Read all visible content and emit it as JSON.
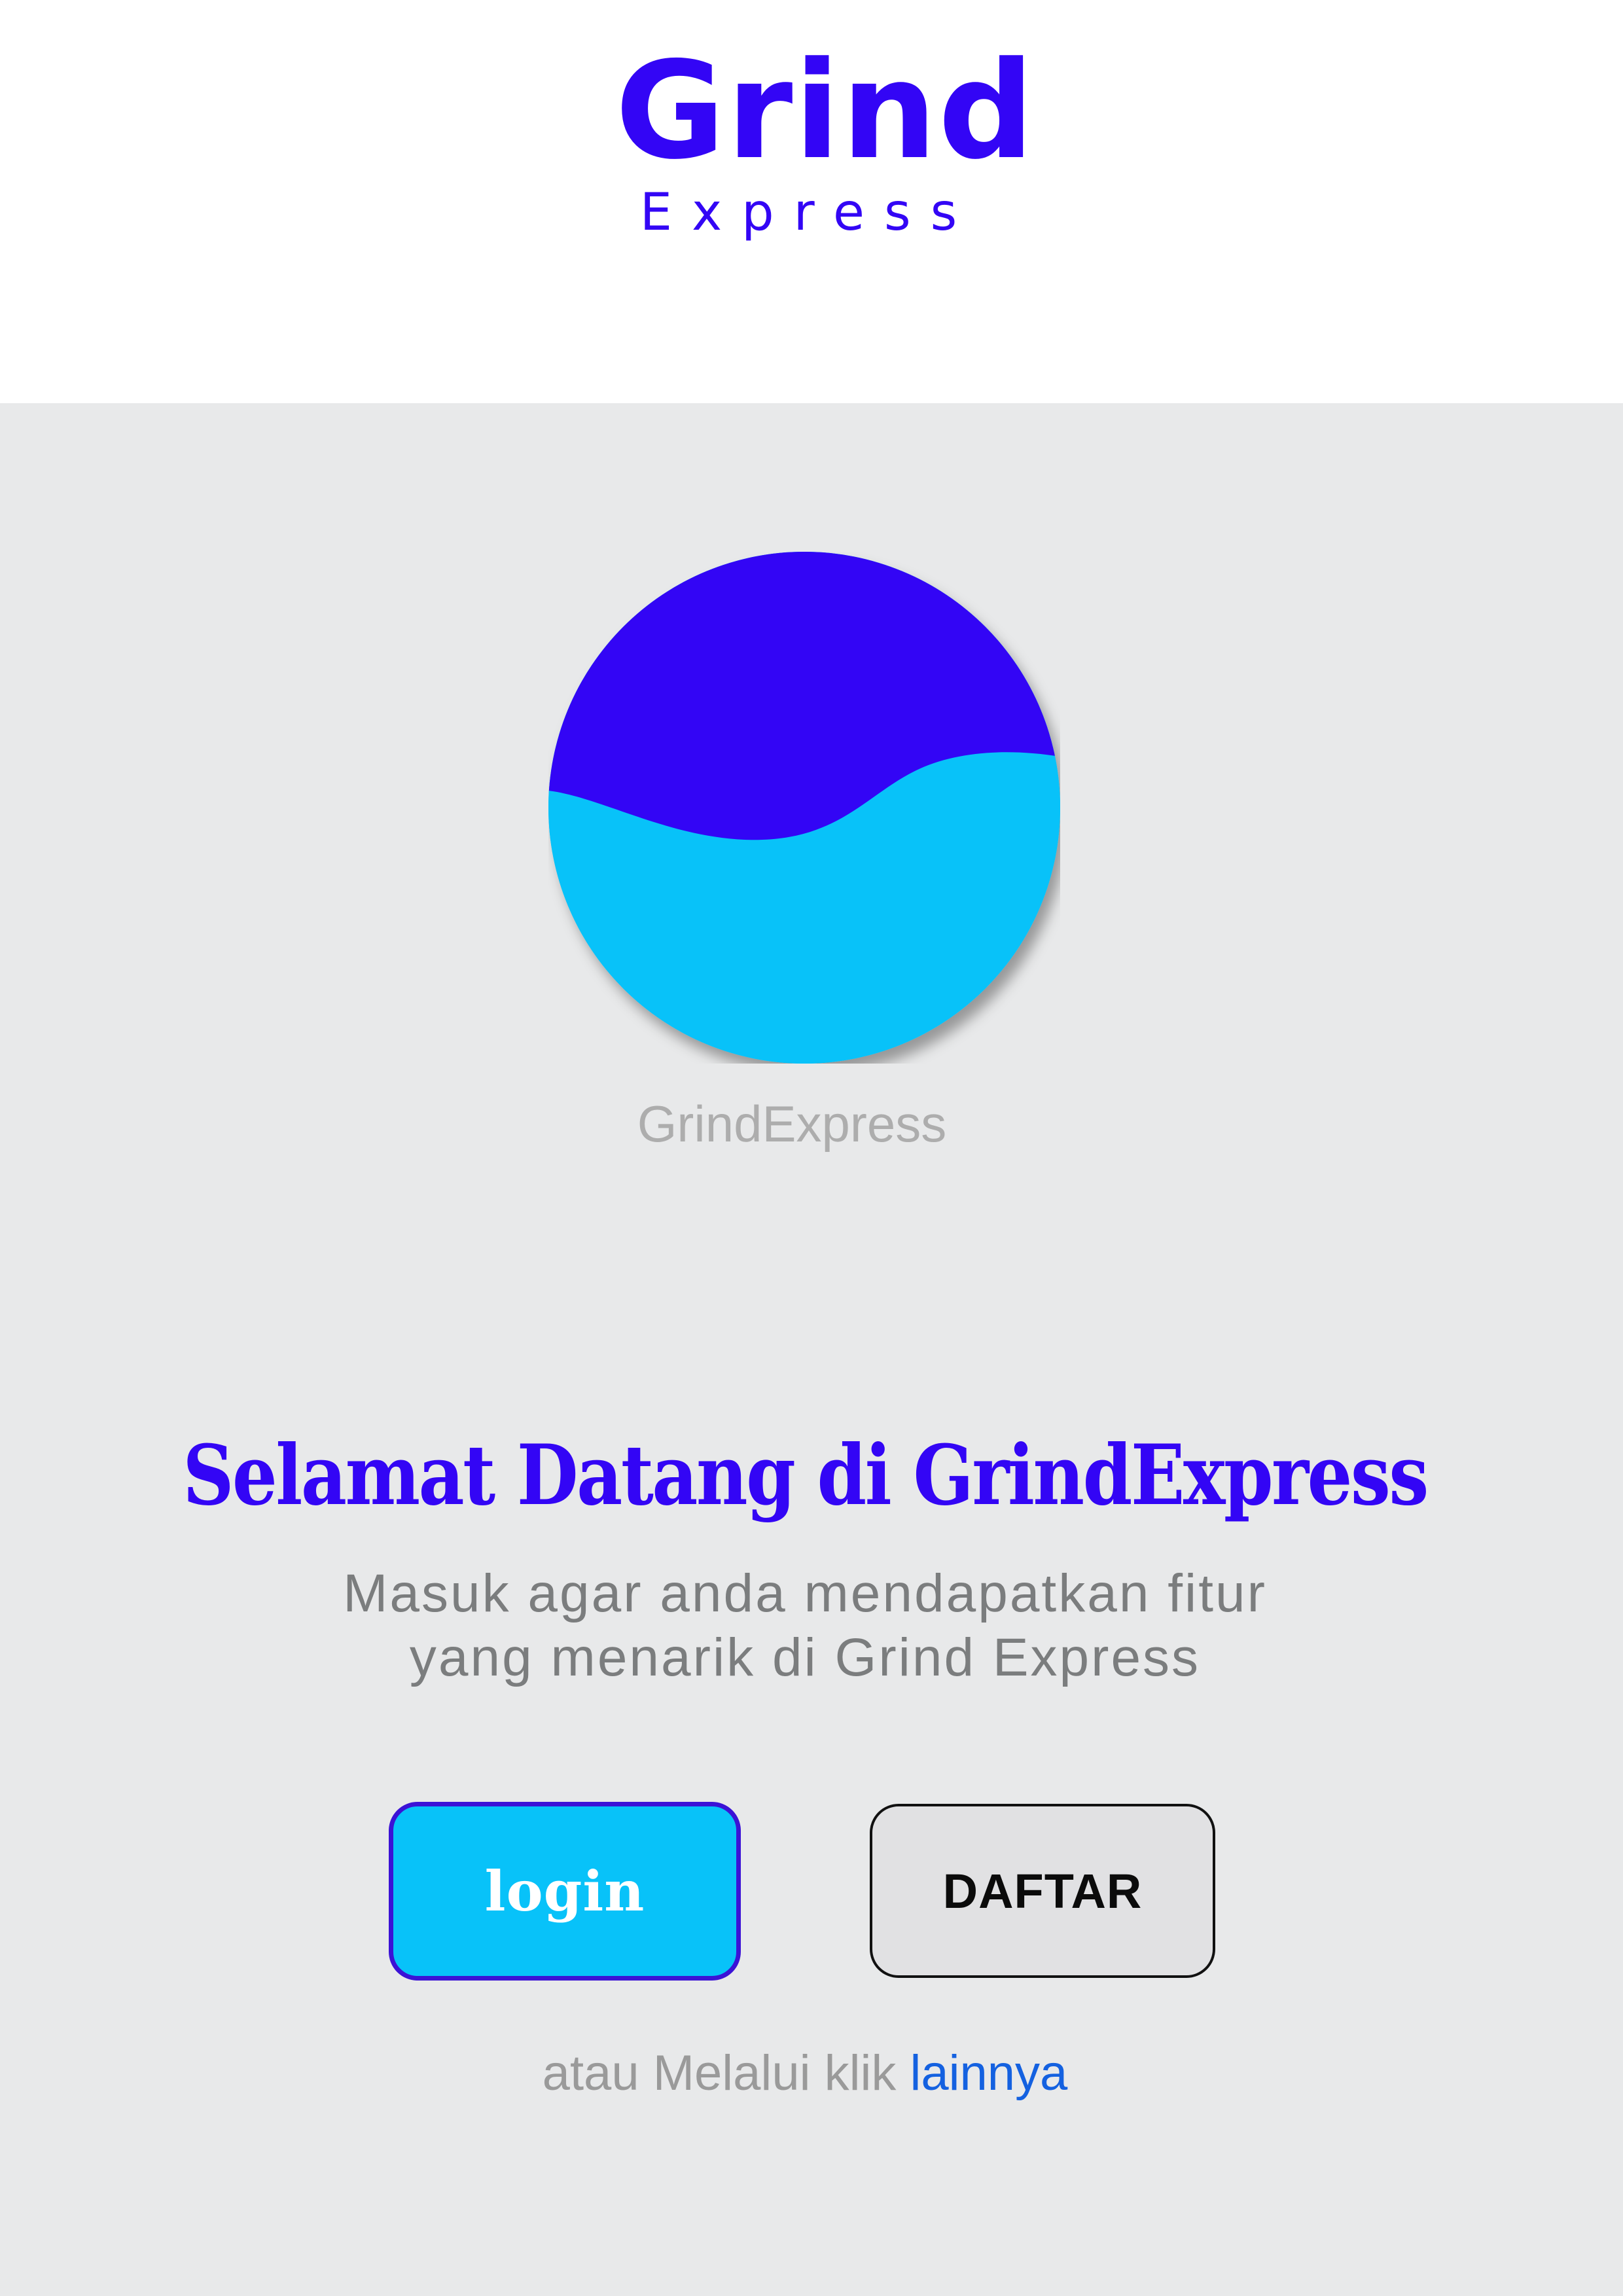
{
  "header": {
    "brand_name": "Grind",
    "brand_sub": "Express"
  },
  "logo": {
    "caption": "GrindExpress",
    "colors": {
      "top": "#3305f5",
      "bottom": "#08c2f9"
    }
  },
  "welcome": {
    "title": "Selamat Datang di GrindExpress",
    "subtitle_line1": "Masuk agar anda mendapatkan fitur",
    "subtitle_line2": "yang menarik di Grind Express"
  },
  "actions": {
    "login_label": "login",
    "register_label": "DAFTAR"
  },
  "alternative": {
    "prefix": "atau Melalui klik ",
    "link_label": "lainnya"
  },
  "colors": {
    "brand": "#3305f5",
    "accent": "#08c2f9",
    "background": "#e8e9ea",
    "link": "#1461e0"
  }
}
